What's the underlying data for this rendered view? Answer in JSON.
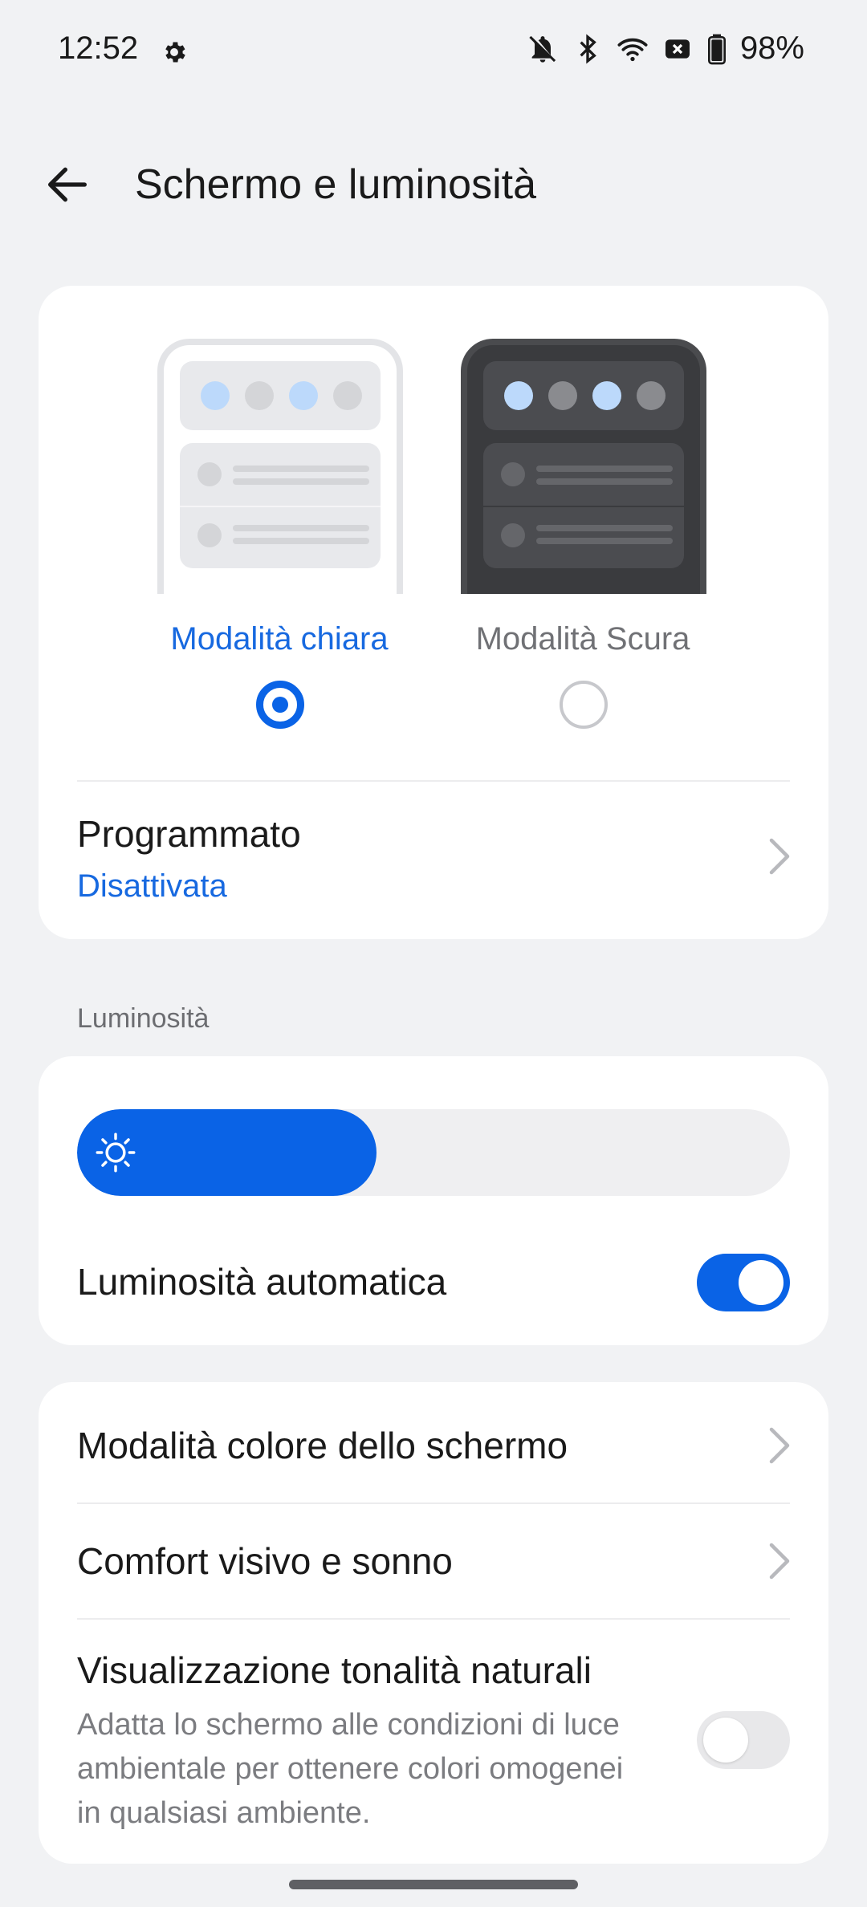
{
  "status_bar": {
    "time": "12:52",
    "battery": "98%",
    "icons": [
      "settings-gear-icon",
      "bell-muted-icon",
      "bluetooth-icon",
      "wifi-icon",
      "sim-off-icon",
      "battery-icon"
    ]
  },
  "header": {
    "title": "Schermo e luminosità",
    "back_icon": "back-arrow-icon"
  },
  "display_mode": {
    "light_label": "Modalità chiara",
    "dark_label": "Modalità Scura",
    "selected": "light",
    "schedule": {
      "title": "Programmato",
      "value": "Disattivata"
    }
  },
  "brightness": {
    "section_label": "Luminosità",
    "level_percent": 42,
    "auto_label": "Luminosità automatica",
    "auto_enabled": true
  },
  "settings": {
    "items": [
      {
        "title": "Modalità colore dello schermo"
      },
      {
        "title": "Comfort visivo e sonno"
      },
      {
        "title": "Visualizzazione tonalità naturali",
        "description": "Adatta lo schermo alle condizioni di luce ambientale per ottenere colori omogenei in qualsiasi ambiente.",
        "enabled": false
      }
    ]
  },
  "colors": {
    "accent": "#0a63e6",
    "background": "#f1f2f4",
    "card": "#ffffff"
  }
}
